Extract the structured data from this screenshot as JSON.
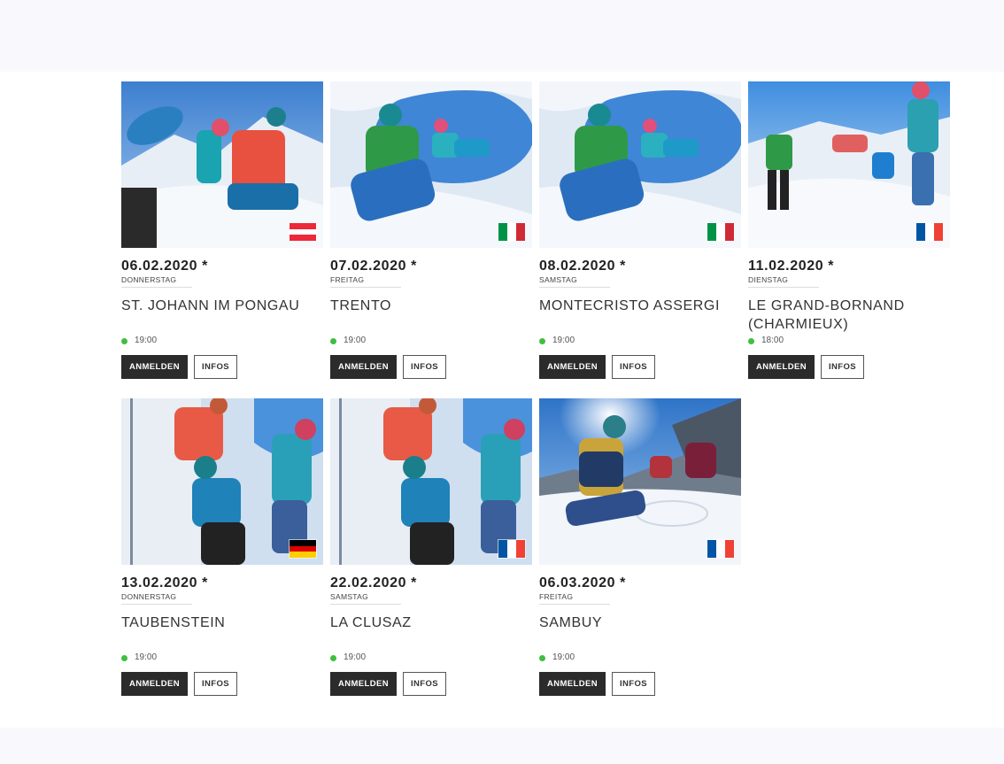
{
  "events": [
    {
      "date": "06.02.2020 *",
      "weekday": "DONNERSTAG",
      "city": "ST. JOHANN IM PONGAU",
      "time": "19:00",
      "flag": "austria-flag",
      "photo": "ski-touring-group-photo",
      "register_label": "ANMELDEN",
      "info_label": "INFOS"
    },
    {
      "date": "07.02.2020 *",
      "weekday": "FREITAG",
      "city": "TRENTO",
      "time": "19:00",
      "flag": "italy-flag",
      "photo": "snow-cave-photo",
      "register_label": "ANMELDEN",
      "info_label": "INFOS"
    },
    {
      "date": "08.02.2020 *",
      "weekday": "SAMSTAG",
      "city": "MONTECRISTO ASSERGI",
      "time": "19:00",
      "flag": "italy-flag",
      "photo": "snow-cave-photo",
      "register_label": "ANMELDEN",
      "info_label": "INFOS"
    },
    {
      "date": "11.02.2020 *",
      "weekday": "DIENSTAG",
      "city": "LE GRAND-BORNAND (CHARMIEUX)",
      "time": "18:00",
      "flag": "france-flag",
      "photo": "avalanche-shovel-photo",
      "register_label": "ANMELDEN",
      "info_label": "INFOS"
    },
    {
      "date": "13.02.2020 *",
      "weekday": "DONNERSTAG",
      "city": "TAUBENSTEIN",
      "time": "19:00",
      "flag": "germany-flag",
      "photo": "snow-profile-photo",
      "register_label": "ANMELDEN",
      "info_label": "INFOS"
    },
    {
      "date": "22.02.2020 *",
      "weekday": "SAMSTAG",
      "city": "LA CLUSAZ",
      "time": "19:00",
      "flag": "france-flag",
      "photo": "snow-profile-photo",
      "register_label": "ANMELDEN",
      "info_label": "INFOS"
    },
    {
      "date": "06.03.2020 *",
      "weekday": "FREITAG",
      "city": "SAMBUY",
      "time": "19:00",
      "flag": "france-flag",
      "photo": "mountain-sun-photo",
      "register_label": "ANMELDEN",
      "info_label": "INFOS"
    }
  ],
  "colors": {
    "status_dot": "#3fbf3f",
    "primary_button": "#2b2b2b",
    "page_band": "#f9f9fd"
  },
  "flags": {
    "austria-flag": {
      "orientation": "horizontal",
      "stripes": [
        "#ed2939",
        "#ffffff",
        "#ed2939"
      ]
    },
    "italy-flag": {
      "orientation": "vertical",
      "stripes": [
        "#009246",
        "#ffffff",
        "#ce2b37"
      ]
    },
    "france-flag": {
      "orientation": "vertical",
      "stripes": [
        "#0055a4",
        "#ffffff",
        "#ef4135"
      ]
    },
    "germany-flag": {
      "orientation": "horizontal",
      "stripes": [
        "#000000",
        "#dd0000",
        "#ffce00"
      ]
    }
  }
}
